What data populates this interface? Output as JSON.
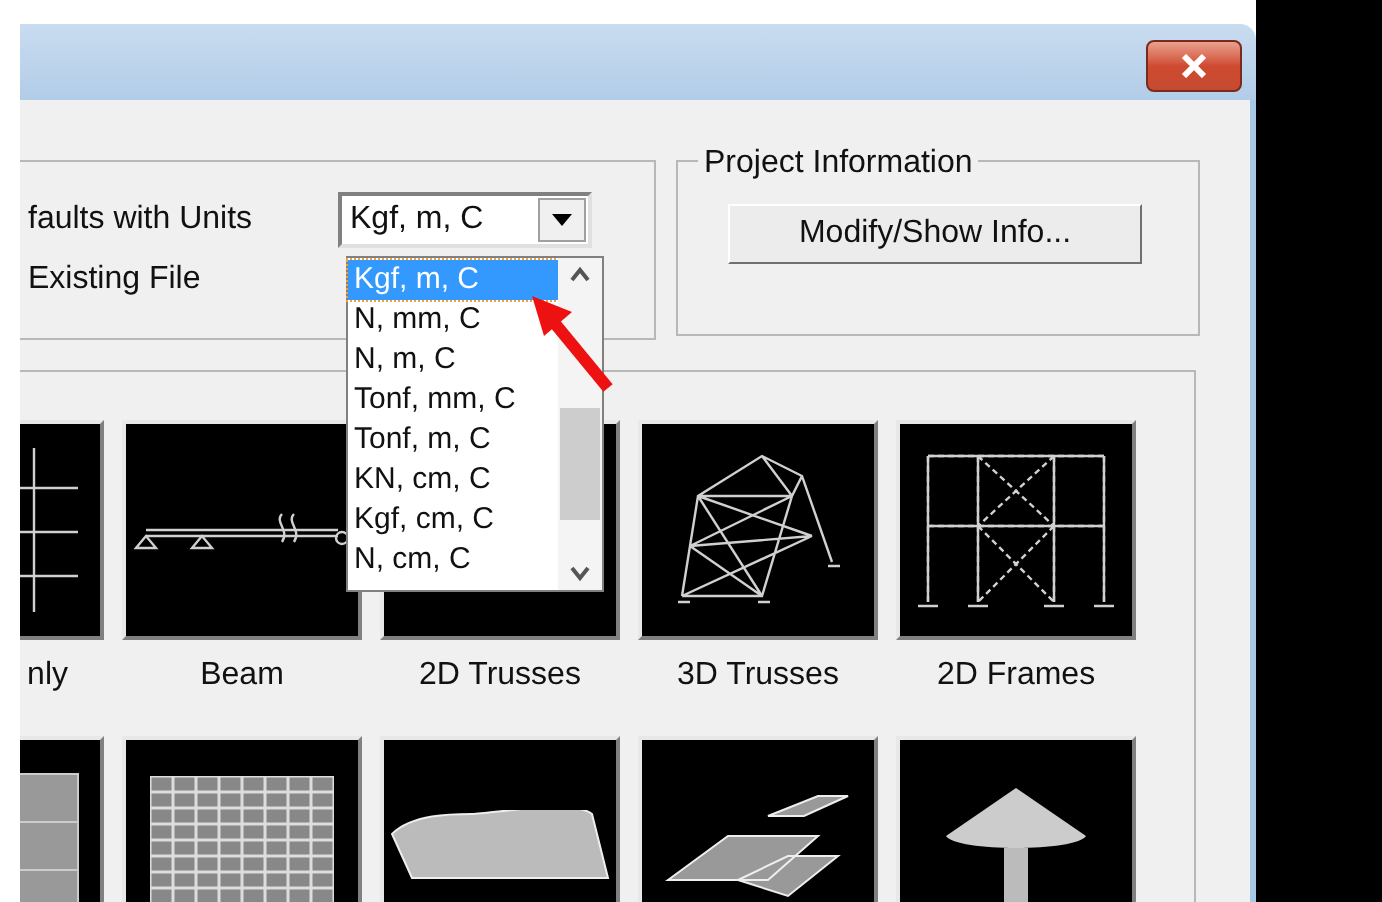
{
  "units_row": {
    "label": "faults with Units",
    "value": "Kgf, m, C"
  },
  "file_row": {
    "label": "Existing File"
  },
  "units_dropdown": {
    "expanded": true,
    "items": [
      {
        "label": "Kgf, m, C",
        "selected": true
      },
      {
        "label": "N, mm, C",
        "selected": false
      },
      {
        "label": "N, m, C",
        "selected": false
      },
      {
        "label": "Tonf, mm, C",
        "selected": false
      },
      {
        "label": "Tonf, m, C",
        "selected": false
      },
      {
        "label": "KN, cm, C",
        "selected": false
      },
      {
        "label": "Kgf, cm, C",
        "selected": false
      },
      {
        "label": "N, cm, C",
        "selected": false
      }
    ]
  },
  "project_information": {
    "title": "Project Information",
    "button": "Modify/Show Info..."
  },
  "templates": [
    {
      "label": "nly",
      "kind": "grid"
    },
    {
      "label": "Beam",
      "kind": "beam"
    },
    {
      "label": "2D Trusses",
      "kind": "truss2d"
    },
    {
      "label": "3D Trusses",
      "kind": "truss3d"
    },
    {
      "label": "2D Frames",
      "kind": "frame2d"
    }
  ],
  "templates_row_2": [
    {
      "kind": "wall"
    },
    {
      "kind": "slab"
    },
    {
      "kind": "shell"
    },
    {
      "kind": "ramp"
    },
    {
      "kind": "dome"
    }
  ]
}
